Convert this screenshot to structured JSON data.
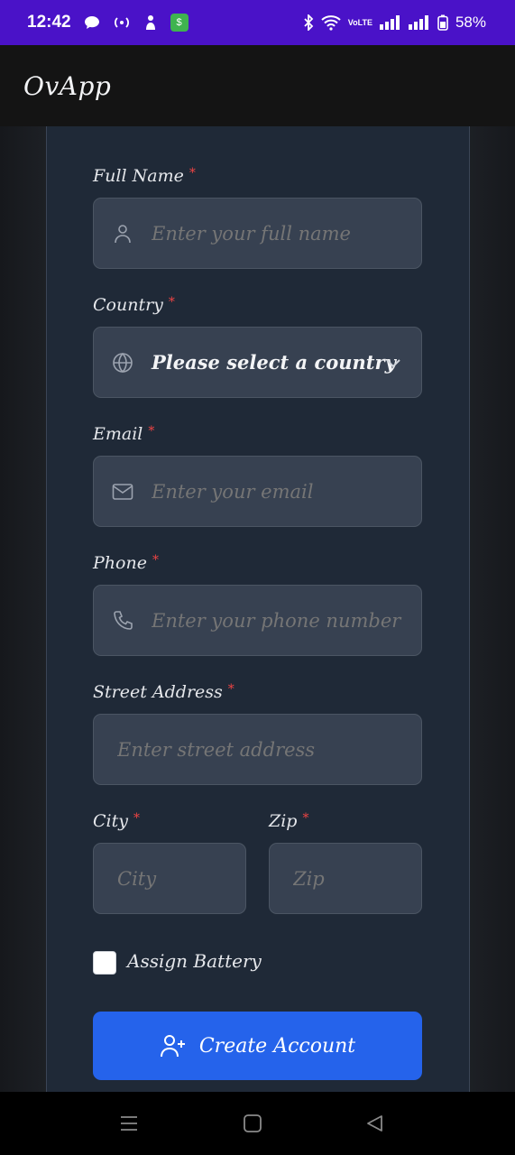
{
  "status_bar": {
    "time": "12:42",
    "battery": "58%",
    "network_label": "VoLTE",
    "icons": [
      "chat-bubble-icon",
      "hotspot-icon",
      "notification-icon",
      "app-icon",
      "bluetooth-icon",
      "wifi-icon",
      "signal-icon",
      "battery-icon"
    ]
  },
  "app": {
    "title": "OvApp"
  },
  "form": {
    "full_name": {
      "label": "Full Name",
      "required": "*",
      "placeholder": "Enter your full name",
      "icon": "user-icon"
    },
    "country": {
      "label": "Country",
      "required": "*",
      "value": "Please select a country",
      "icon": "globe-icon"
    },
    "email": {
      "label": "Email",
      "required": "*",
      "placeholder": "Enter your email",
      "icon": "mail-icon"
    },
    "phone": {
      "label": "Phone",
      "required": "*",
      "placeholder": "Enter your phone number",
      "icon": "phone-icon"
    },
    "street": {
      "label": "Street Address",
      "required": "*",
      "placeholder": "Enter street address"
    },
    "city": {
      "label": "City",
      "required": "*",
      "placeholder": "City"
    },
    "zip": {
      "label": "Zip",
      "required": "*",
      "placeholder": "Zip"
    },
    "assign_battery": {
      "label": "Assign Battery",
      "checked": false
    },
    "submit": {
      "label": "Create Account",
      "icon": "user-plus-icon"
    }
  },
  "colors": {
    "status_bar": "#4a12c8",
    "card": "#1f2937",
    "input": "#374151",
    "primary": "#2563eb",
    "required": "#ef4444"
  }
}
